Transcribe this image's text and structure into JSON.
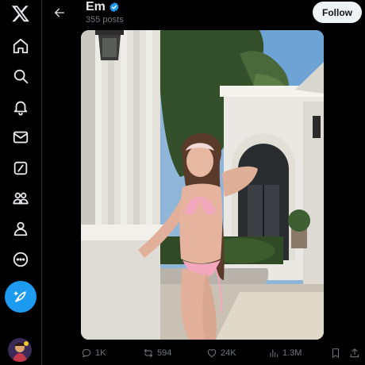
{
  "header": {
    "name": "Em",
    "posts": "355 posts",
    "follow_label": "Follow"
  },
  "nav": {
    "items": [
      "x-logo-icon",
      "home-icon",
      "search-icon",
      "notifications-bell-icon",
      "messages-envelope-icon",
      "grok-slash-icon",
      "communities-people-icon",
      "profile-person-icon",
      "more-circle-icon"
    ],
    "compose_icon": "compose-feather-icon"
  },
  "colors": {
    "accent": "#1d9bf0",
    "background": "#000000",
    "muted": "#71767b"
  },
  "stats": {
    "replies": "1K",
    "reposts": "594",
    "likes": "24K",
    "views": "1.3M"
  }
}
